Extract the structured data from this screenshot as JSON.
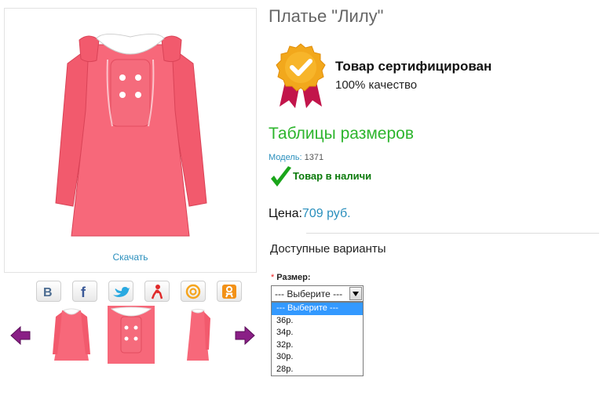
{
  "product": {
    "title": "Платье \"Лилу\"",
    "download_label": "Скачать",
    "certified_title": "Товар сертифицирован",
    "certified_sub": "100% качество",
    "size_tables_link": "Таблицы размеров",
    "model_label": "Модель:",
    "model_value": "1371",
    "stock_status": "Товар в наличи",
    "price_label": "Цена:",
    "price_value": "709 руб.",
    "variants_heading": "Доступные варианты",
    "size_required_mark": "*",
    "size_label": "Размер:"
  },
  "select": {
    "current": "--- Выберите ---",
    "options": [
      "--- Выберите ---",
      "36р.",
      "34р.",
      "32р.",
      "30р.",
      "28р."
    ],
    "selected_index": 0
  },
  "share": [
    "vkontakte-icon",
    "facebook-icon",
    "twitter-icon",
    "odnoklassniki-person-icon",
    "mail-at-icon",
    "odnoklassniki-icon"
  ],
  "colors": {
    "dress": "#f25a6d",
    "link_blue": "#2a8fbd",
    "green": "#2db52d",
    "arrow": "#8a1f86"
  }
}
